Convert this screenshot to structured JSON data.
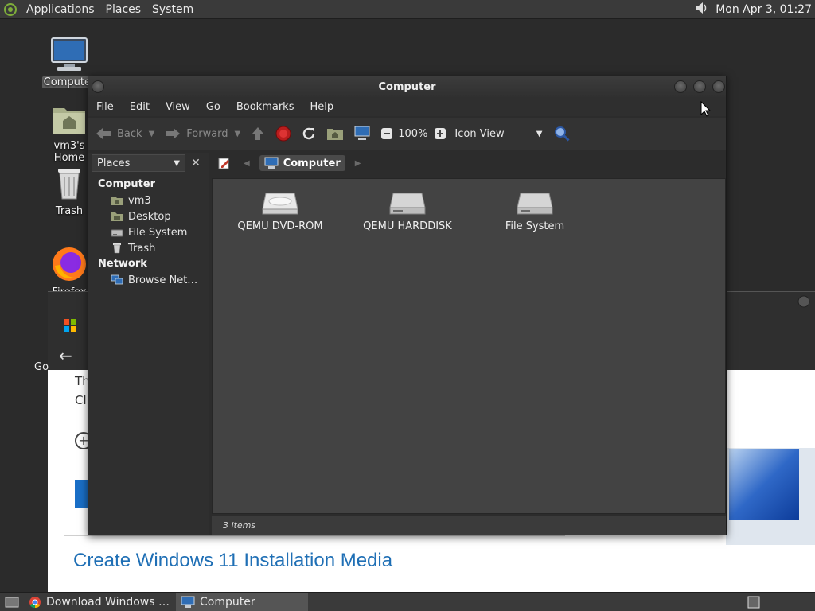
{
  "top_panel": {
    "menus": [
      "Applications",
      "Places",
      "System"
    ],
    "clock": "Mon Apr  3, 01:27"
  },
  "desktop": {
    "icons": [
      {
        "label": "Computer"
      },
      {
        "label": "vm3's Home"
      },
      {
        "label": "Trash"
      },
      {
        "label": "Firefox"
      }
    ]
  },
  "background_browser": {
    "heading": "Create Windows 11 Installation Media",
    "snippet_line1": "Th",
    "snippet_line2": "Cli",
    "left_label": "Go"
  },
  "window": {
    "title": "Computer",
    "menu": [
      "File",
      "Edit",
      "View",
      "Go",
      "Bookmarks",
      "Help"
    ],
    "toolbar": {
      "back": "Back",
      "forward": "Forward",
      "zoom": "100%",
      "view_mode": "Icon View"
    },
    "sidebar": {
      "header": "Places",
      "groups": [
        {
          "title": "Computer",
          "items": [
            "vm3",
            "Desktop",
            "File System",
            "Trash"
          ]
        },
        {
          "title": "Network",
          "items": [
            "Browse Net…"
          ]
        }
      ]
    },
    "location": {
      "crumb": "Computer"
    },
    "items": [
      {
        "label": "QEMU DVD-ROM",
        "icon": "optical-drive-icon"
      },
      {
        "label": "QEMU HARDDISK",
        "icon": "harddisk-icon"
      },
      {
        "label": "File System",
        "icon": "filesystem-icon"
      }
    ],
    "status": "3 items"
  },
  "taskbar": {
    "tasks": [
      "Download Windows …",
      "Computer"
    ]
  },
  "colors": {
    "panel": "#3a3a3a",
    "window_bg": "#2c2c2c",
    "view_bg": "#434343",
    "link_blue": "#1f6fb5"
  }
}
